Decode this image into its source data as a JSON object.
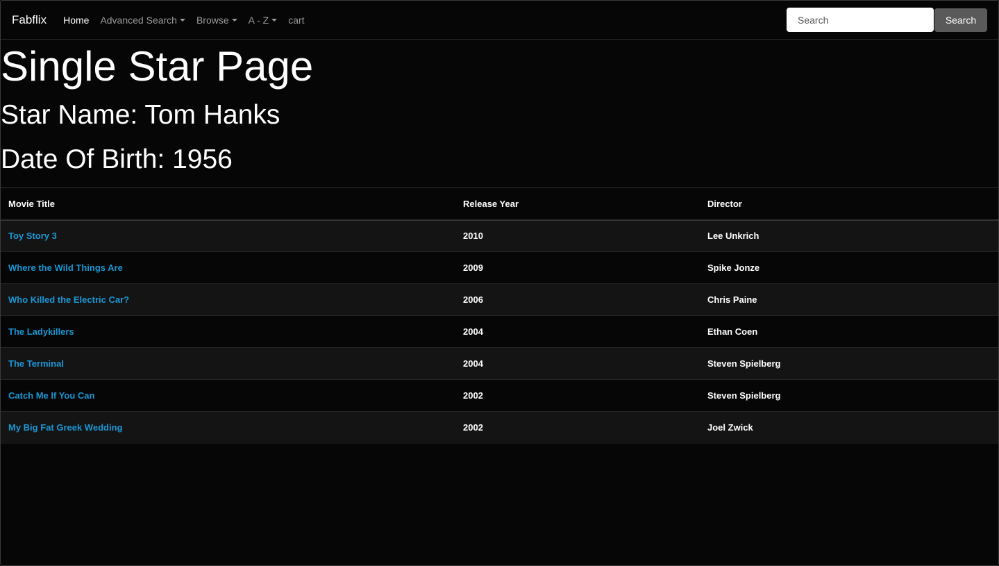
{
  "navbar": {
    "brand": "Fabflix",
    "items": [
      {
        "label": "Home",
        "dropdown": false,
        "active": true
      },
      {
        "label": "Advanced Search",
        "dropdown": true,
        "active": false
      },
      {
        "label": "Browse",
        "dropdown": true,
        "active": false
      },
      {
        "label": "A - Z",
        "dropdown": true,
        "active": false
      },
      {
        "label": "cart",
        "dropdown": false,
        "active": false
      }
    ],
    "search": {
      "placeholder": "Search",
      "button_label": "Search"
    }
  },
  "page": {
    "title": "Single Star Page",
    "star_name": "Star Name: Tom Hanks",
    "dob": "Date Of Birth: 1956"
  },
  "table": {
    "headers": [
      "Movie Title",
      "Release Year",
      "Director"
    ],
    "rows": [
      {
        "title": "Toy Story 3",
        "year": "2010",
        "director": "Lee Unkrich"
      },
      {
        "title": "Where the Wild Things Are",
        "year": "2009",
        "director": "Spike Jonze"
      },
      {
        "title": "Who Killed the Electric Car?",
        "year": "2006",
        "director": "Chris Paine"
      },
      {
        "title": "The Ladykillers",
        "year": "2004",
        "director": "Ethan Coen"
      },
      {
        "title": "The Terminal",
        "year": "2004",
        "director": "Steven Spielberg"
      },
      {
        "title": "Catch Me If You Can",
        "year": "2002",
        "director": "Steven Spielberg"
      },
      {
        "title": "My Big Fat Greek Wedding",
        "year": "2002",
        "director": "Joel Zwick"
      }
    ]
  },
  "colors": {
    "background": "#060606",
    "link": "#1a97d4",
    "stripe": "#141414",
    "search_button": "#5a5a5a"
  }
}
